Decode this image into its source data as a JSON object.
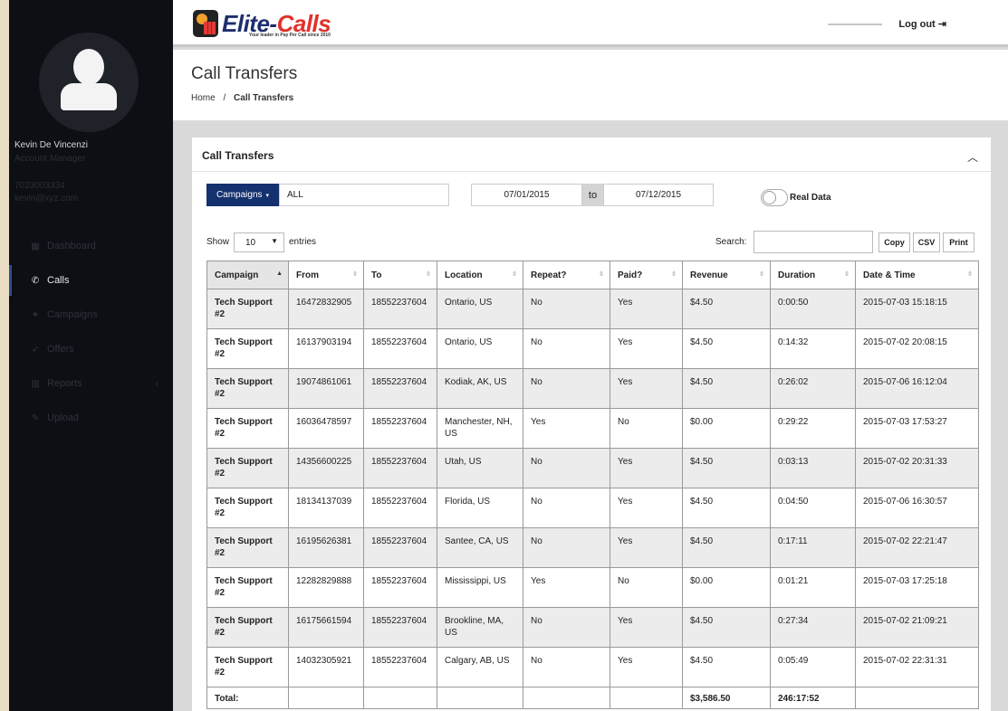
{
  "sidebar": {
    "user_name": "Kevin De Vincenzi",
    "user_role": "Account Manager",
    "user_phone": "7023003334",
    "user_email": "kevin@xyz.com",
    "nav": [
      {
        "label": "Dashboard",
        "icon": "dashboard-icon"
      },
      {
        "label": "Calls",
        "icon": "phone-icon"
      },
      {
        "label": "Campaigns",
        "icon": "campaigns-icon"
      },
      {
        "label": "Offers",
        "icon": "offers-icon"
      },
      {
        "label": "Reports",
        "icon": "reports-icon"
      },
      {
        "label": "Upload",
        "icon": "upload-icon"
      }
    ]
  },
  "topbar": {
    "logo_word1": "Elite-",
    "logo_word2": "Calls",
    "tagline": "Your leader in Pay Per Call since 2010",
    "logout_label": "Log out"
  },
  "header": {
    "title": "Call Transfers",
    "breadcrumb_home": "Home",
    "breadcrumb_sep": "/",
    "breadcrumb_current": "Call Transfers"
  },
  "panel": {
    "title": "Call Transfers",
    "campaigns_button": "Campaigns",
    "campaign_value": "ALL",
    "date_from": "07/01/2015",
    "to_label": "to",
    "date_to": "07/12/2015",
    "real_data_label": "Real Data",
    "show_label": "Show",
    "entries_value": "10",
    "entries_label": "entries",
    "search_label": "Search:",
    "copy_label": "Copy",
    "csv_label": "CSV",
    "print_label": "Print"
  },
  "table": {
    "columns": [
      "Campaign",
      "From",
      "To",
      "Location",
      "Repeat?",
      "Paid?",
      "Revenue",
      "Duration",
      "Date & Time"
    ],
    "rows": [
      [
        "Tech Support #2",
        "16472832905",
        "18552237604",
        "Ontario, US",
        "No",
        "Yes",
        "$4.50",
        "0:00:50",
        "2015-07-03 15:18:15"
      ],
      [
        "Tech Support #2",
        "16137903194",
        "18552237604",
        "Ontario, US",
        "No",
        "Yes",
        "$4.50",
        "0:14:32",
        "2015-07-02 20:08:15"
      ],
      [
        "Tech Support #2",
        "19074861061",
        "18552237604",
        "Kodiak, AK, US",
        "No",
        "Yes",
        "$4.50",
        "0:26:02",
        "2015-07-06 16:12:04"
      ],
      [
        "Tech Support #2",
        "16036478597",
        "18552237604",
        "Manchester, NH, US",
        "Yes",
        "No",
        "$0.00",
        "0:29:22",
        "2015-07-03 17:53:27"
      ],
      [
        "Tech Support #2",
        "14356600225",
        "18552237604",
        "Utah, US",
        "No",
        "Yes",
        "$4.50",
        "0:03:13",
        "2015-07-02 20:31:33"
      ],
      [
        "Tech Support #2",
        "18134137039",
        "18552237604",
        "Florida, US",
        "No",
        "Yes",
        "$4.50",
        "0:04:50",
        "2015-07-06 16:30:57"
      ],
      [
        "Tech Support #2",
        "16195626381",
        "18552237604",
        "Santee, CA, US",
        "No",
        "Yes",
        "$4.50",
        "0:17:11",
        "2015-07-02 22:21:47"
      ],
      [
        "Tech Support #2",
        "12282829888",
        "18552237604",
        "Mississippi, US",
        "Yes",
        "No",
        "$0.00",
        "0:01:21",
        "2015-07-03 17:25:18"
      ],
      [
        "Tech Support #2",
        "16175661594",
        "18552237604",
        "Brookline, MA, US",
        "No",
        "Yes",
        "$4.50",
        "0:27:34",
        "2015-07-02 21:09:21"
      ],
      [
        "Tech Support #2",
        "14032305921",
        "18552237604",
        "Calgary, AB, US",
        "No",
        "Yes",
        "$4.50",
        "0:05:49",
        "2015-07-02 22:31:31"
      ]
    ],
    "total": {
      "label": "Total:",
      "revenue": "$3,586.50",
      "duration": "246:17:52"
    }
  }
}
